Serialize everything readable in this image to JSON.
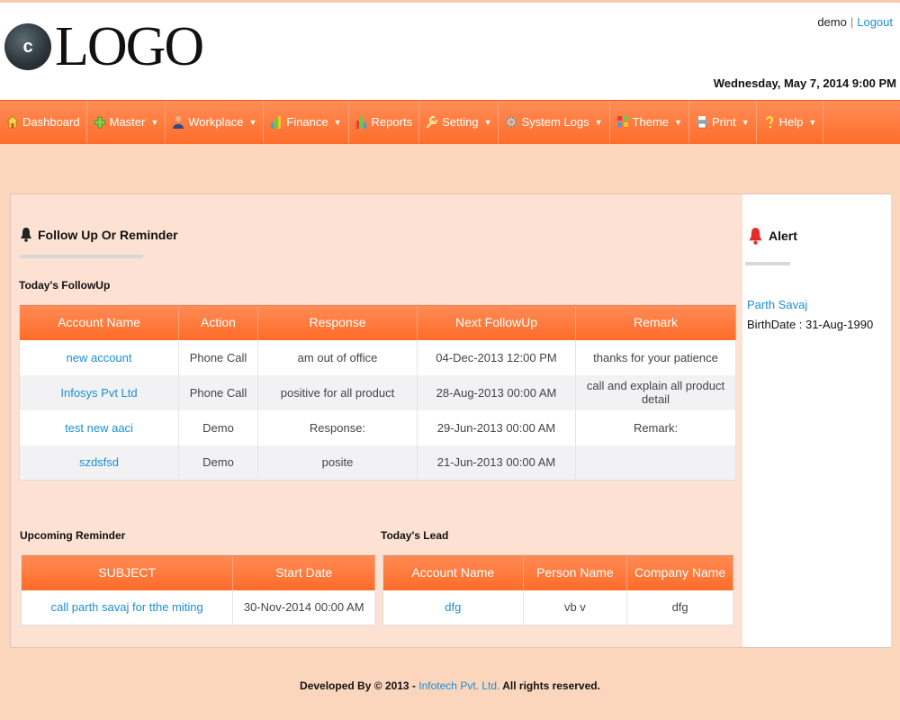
{
  "header": {
    "logo_text": "LOGO",
    "logo_mark": "c",
    "user": "demo",
    "separator": "|",
    "logout": "Logout",
    "datetime": "Wednesday, May 7, 2014 9:00 PM"
  },
  "nav": [
    {
      "label": "Dashboard",
      "icon": "home-icon",
      "dropdown": false
    },
    {
      "label": "Master",
      "icon": "plus-icon",
      "dropdown": true
    },
    {
      "label": "Workplace",
      "icon": "person-icon",
      "dropdown": true
    },
    {
      "label": "Finance",
      "icon": "bar-chart-icon",
      "dropdown": true
    },
    {
      "label": "Reports",
      "icon": "bar-chart-icon",
      "dropdown": false
    },
    {
      "label": "Setting",
      "icon": "wrench-icon",
      "dropdown": false
    },
    {
      "label": "System Logs",
      "icon": "gear-icon",
      "dropdown": true
    },
    {
      "label": "Theme",
      "icon": "palette-icon",
      "dropdown": true
    },
    {
      "label": "Print",
      "icon": "printer-icon",
      "dropdown": true
    },
    {
      "label": "Help",
      "icon": "question-icon",
      "dropdown": true
    }
  ],
  "followup": {
    "title": "Follow Up Or Reminder",
    "subtitle": "Today's FollowUp",
    "columns": [
      "Account Name",
      "Action",
      "Response",
      "Next FollowUp",
      "Remark"
    ],
    "rows": [
      [
        "new account",
        "Phone Call",
        "am out of office",
        "04-Dec-2013 12:00 PM",
        "thanks for your patience"
      ],
      [
        "Infosys Pvt Ltd",
        "Phone Call",
        "positive for all product",
        "28-Aug-2013 00:00 AM",
        "call and explain all product detail"
      ],
      [
        "test new aaci",
        "Demo",
        "Response:",
        "29-Jun-2013 00:00 AM",
        "Remark:"
      ],
      [
        "szdsfsd",
        "Demo",
        "posite",
        "21-Jun-2013 00:00 AM",
        ""
      ]
    ]
  },
  "reminder": {
    "title": "Upcoming Reminder",
    "columns": [
      "SUBJECT",
      "Start Date"
    ],
    "rows": [
      [
        "call parth savaj for tthe miting",
        "30-Nov-2014 00:00 AM"
      ]
    ]
  },
  "lead": {
    "title": "Today's Lead",
    "columns": [
      "Account Name",
      "Person Name",
      "Company Name"
    ],
    "rows": [
      [
        "dfg",
        "vb v",
        "dfg"
      ]
    ]
  },
  "alert": {
    "title": "Alert",
    "name": "Parth Savaj",
    "birthdate": "BirthDate : 31-Aug-1990"
  },
  "footer": {
    "prefix": "Developed By © 2013 -",
    "company": "Infotech Pvt. Ltd.",
    "suffix": "All rights reserved."
  },
  "colors": {
    "accent": "#ff7335",
    "link": "#1a8fd6",
    "background": "#fcd5bd"
  }
}
